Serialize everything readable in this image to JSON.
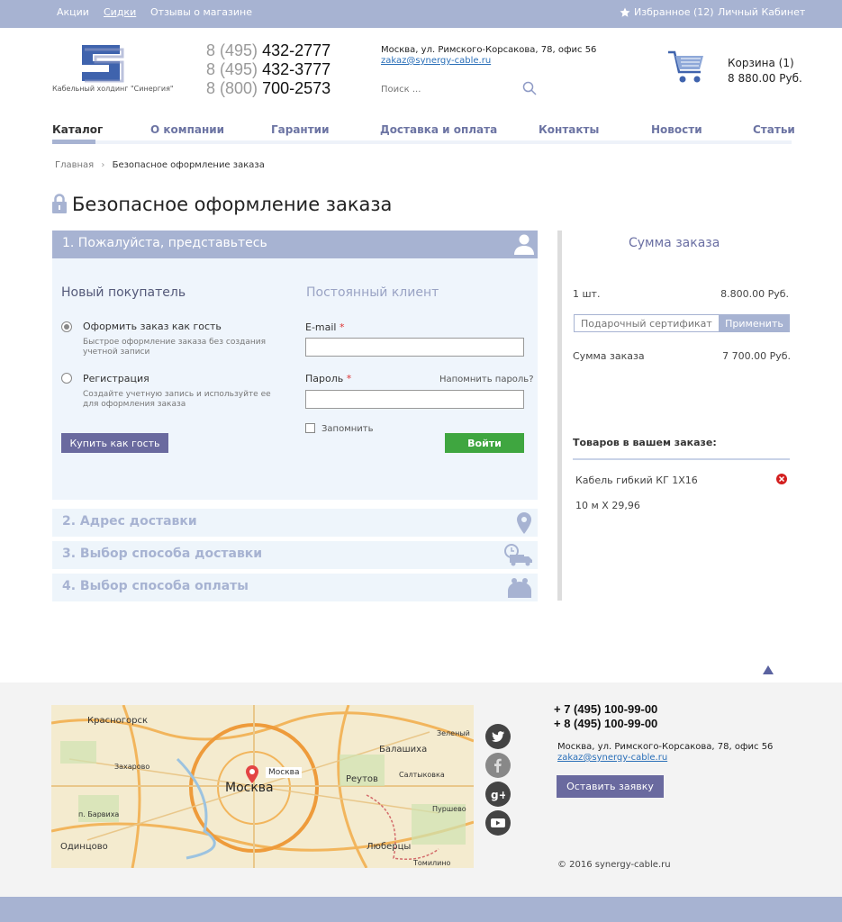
{
  "topbar": {
    "links": [
      "Акции",
      "Сидки",
      "Отзывы о магазине"
    ],
    "favorites": "Избранное (12)",
    "account": "Личный Кабинет"
  },
  "header": {
    "logo_caption": "Кабельный холдинг \"Синергия\"",
    "phones": [
      {
        "code": "8 (495)",
        "number": "432-2777"
      },
      {
        "code": "8 (495)",
        "number": "432-3777"
      },
      {
        "code": "8 (800)",
        "number": "700-2573"
      }
    ],
    "address": "Москва, ул. Римского-Корсакова, 78, офис 56",
    "email": "zakaz@synergy-cable.ru",
    "search_placeholder": "Поиск ...",
    "cart_label": "Корзина (1)",
    "cart_sum": "8 880.00 Руб."
  },
  "nav": [
    "Каталог",
    "О компании",
    "Гарантии",
    "Доставка и оплата",
    "Контакты",
    "Новости",
    "Статьи"
  ],
  "breadcrumb": {
    "home": "Главная",
    "current": "Безопасное оформление заказа"
  },
  "page_title": "Безопасное оформление заказа",
  "step1": {
    "title": "1. Пожалуйста, представьтесь",
    "new_buyer": "Новый покупатель",
    "returning": "Постоянный клиент",
    "opt_guest": "Оформить заказ как гость",
    "opt_guest_sub": "Быстрое оформление заказа без создания учетной записи",
    "opt_reg": "Регистрация",
    "opt_reg_sub": "Создайте учетную запись и используйте ее для оформления заказа",
    "guest_button": "Купить как гость",
    "email_label": "E-mail",
    "password_label": "Пароль",
    "required_mark": "*",
    "forgot": "Напомнить пароль?",
    "remember": "Запомнить",
    "login_button": "Войти"
  },
  "steps": [
    "2. Адрес доставки",
    "3. Выбор способа доставки",
    "4. Выбор способа оплаты"
  ],
  "summary": {
    "title": "Сумма заказа",
    "qty": "1 шт.",
    "qty_price": "8.800.00 Руб.",
    "cert_placeholder": "Подарочный сертификат",
    "apply": "Применить",
    "total_label": "Сумма заказа",
    "total": "7 700.00 Руб.",
    "items_title": "Товаров в вашем заказе:",
    "item_name": "Кабель гибкий КГ 1Х16",
    "item_qty": "10 м Х  29,96"
  },
  "footer": {
    "phones": [
      "+ 7 (495) 100-99-00",
      "+ 8 (495) 100-99-00"
    ],
    "address": "Москва, ул. Римского-Корсакова, 78, офис 56",
    "email": "zakaz@synergy-cable.ru",
    "request_button": "Оставить заявку",
    "copyright": "© 2016 synergy-cable.ru",
    "map_labels": [
      "Красногорск",
      "Москва",
      "Москва",
      "Балашиха",
      "Реутов",
      "Люберцы",
      "Одинцово",
      "Зеленый",
      "Салтыковка",
      "Захарово",
      "Пуршево",
      "Томилино",
      "п. Барвиха"
    ]
  },
  "colors": {
    "accent": "#a7b3d2",
    "button": "#6a6a9f",
    "login": "#3fa640",
    "panel": "#eff5fc"
  }
}
